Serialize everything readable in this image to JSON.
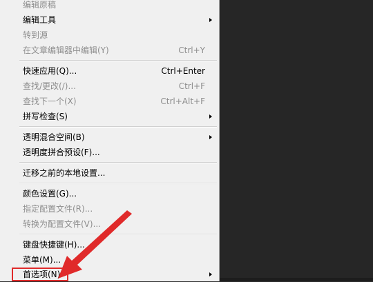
{
  "menu": {
    "items": [
      {
        "label": "编辑原稿",
        "shortcut": "",
        "disabled": true,
        "submenu": false
      },
      {
        "label": "编辑工具",
        "shortcut": "",
        "disabled": false,
        "submenu": true
      },
      {
        "label": "转到源",
        "shortcut": "",
        "disabled": true,
        "submenu": false
      },
      {
        "label": "在文章编辑器中编辑(Y)",
        "shortcut": "Ctrl+Y",
        "disabled": true,
        "submenu": false
      },
      {
        "label": "快速应用(Q)...",
        "shortcut": "Ctrl+Enter",
        "disabled": false,
        "submenu": false
      },
      {
        "label": "查找/更改(/)...",
        "shortcut": "Ctrl+F",
        "disabled": true,
        "submenu": false
      },
      {
        "label": "查找下一个(X)",
        "shortcut": "Ctrl+Alt+F",
        "disabled": true,
        "submenu": false
      },
      {
        "label": "拼写检查(S)",
        "shortcut": "",
        "disabled": false,
        "submenu": true
      },
      {
        "label": "透明混合空间(B)",
        "shortcut": "",
        "disabled": false,
        "submenu": true
      },
      {
        "label": "透明度拼合预设(F)...",
        "shortcut": "",
        "disabled": false,
        "submenu": false
      },
      {
        "label": "迁移之前的本地设置...",
        "shortcut": "",
        "disabled": false,
        "submenu": false
      },
      {
        "label": "颜色设置(G)...",
        "shortcut": "",
        "disabled": false,
        "submenu": false
      },
      {
        "label": "指定配置文件(R)...",
        "shortcut": "",
        "disabled": true,
        "submenu": false
      },
      {
        "label": "转换为配置文件(V)...",
        "shortcut": "",
        "disabled": true,
        "submenu": false
      },
      {
        "label": "键盘快捷键(H)...",
        "shortcut": "",
        "disabled": false,
        "submenu": false
      },
      {
        "label": "菜单(M)...",
        "shortcut": "",
        "disabled": false,
        "submenu": false
      },
      {
        "label": "首选项(N)",
        "shortcut": "",
        "disabled": false,
        "submenu": true
      }
    ]
  },
  "annotation": {
    "color": "#e02a2a"
  }
}
